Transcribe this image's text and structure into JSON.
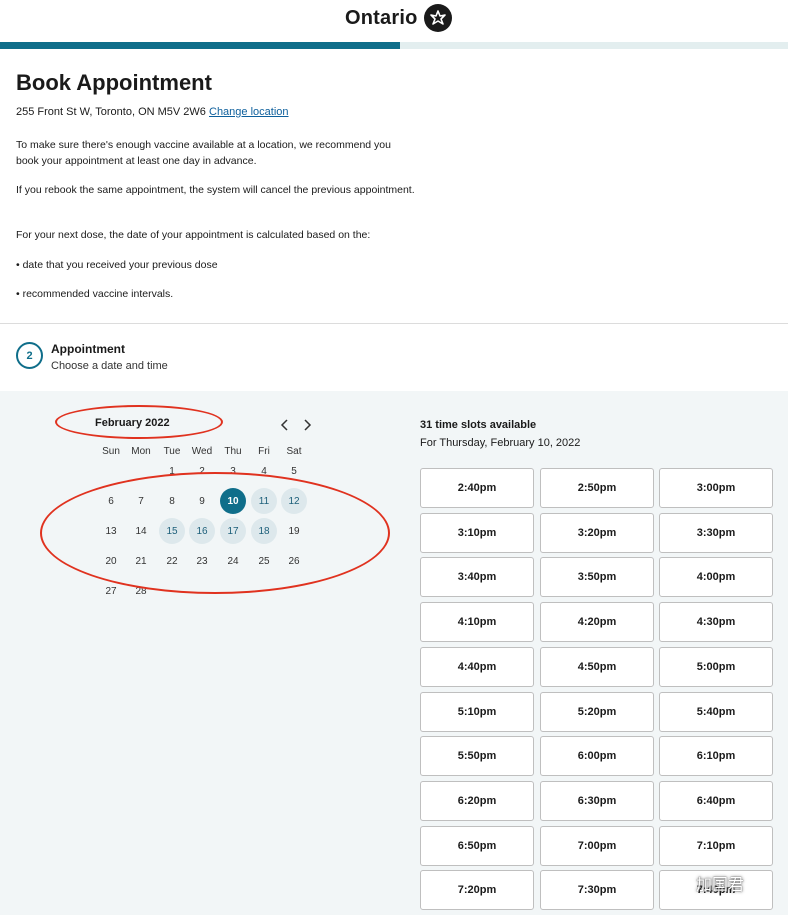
{
  "header": {
    "brand": "Ontario"
  },
  "progress": {
    "percent": 50.8,
    "fill_color": "#0f6e8a",
    "track_color": "#e3eeef"
  },
  "page": {
    "title": "Book Appointment",
    "address": "255 Front St W, Toronto, ON M5V 2W6",
    "change_location": "Change location",
    "paragraphs": [
      "To make sure there's enough vaccine available at a location, we recommend you book your appointment at least one day in advance.",
      "If you rebook the same appointment, the system will cancel the previous appointment.",
      "For your next dose, the date of your appointment is calculated based on the:",
      "• date that you received your previous dose",
      "• recommended vaccine intervals."
    ]
  },
  "step": {
    "number": "2",
    "title": "Appointment",
    "subtitle": "Choose a date and time"
  },
  "calendar": {
    "month": "February 2022",
    "prev_icon": "chevron-left-icon",
    "next_icon": "chevron-right-icon",
    "weekdays": [
      "Sun",
      "Mon",
      "Tue",
      "Wed",
      "Thu",
      "Fri",
      "Sat"
    ],
    "weeks": [
      [
        "",
        "",
        "1",
        "2",
        "3",
        "4",
        "5"
      ],
      [
        "6",
        "7",
        "8",
        "9",
        "10",
        "11",
        "12"
      ],
      [
        "13",
        "14",
        "15",
        "16",
        "17",
        "18",
        "19"
      ],
      [
        "20",
        "21",
        "22",
        "23",
        "24",
        "25",
        "26"
      ],
      [
        "27",
        "28",
        "",
        "",
        "",
        "",
        ""
      ]
    ],
    "selected": "10",
    "available": [
      "11",
      "12",
      "15",
      "16",
      "17",
      "18"
    ]
  },
  "slots": {
    "count_text": "31 time slots available",
    "for_text": "For Thursday, February 10, 2022",
    "times": [
      "2:40pm",
      "2:50pm",
      "3:00pm",
      "3:10pm",
      "3:20pm",
      "3:30pm",
      "3:40pm",
      "3:50pm",
      "4:00pm",
      "4:10pm",
      "4:20pm",
      "4:30pm",
      "4:40pm",
      "4:50pm",
      "5:00pm",
      "5:10pm",
      "5:20pm",
      "5:40pm",
      "5:50pm",
      "6:00pm",
      "6:10pm",
      "6:20pm",
      "6:30pm",
      "6:40pm",
      "6:50pm",
      "7:00pm",
      "7:10pm",
      "7:20pm",
      "7:30pm",
      "7:40pm"
    ]
  },
  "watermark": {
    "text": "加国君",
    "icon": "wechat-icon"
  },
  "colors": {
    "accent": "#0f6e8a",
    "annotation": "#e0321f"
  }
}
